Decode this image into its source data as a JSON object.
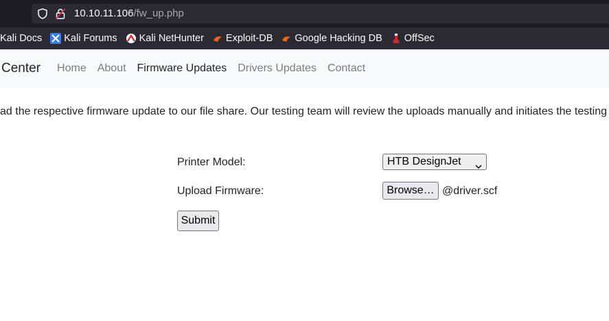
{
  "browser": {
    "url_host": "10.10.11.106",
    "url_path": "/fw_up.php",
    "bookmarks": [
      {
        "label": "Kali Docs",
        "icon": "kali-icon"
      },
      {
        "label": "Kali Forums",
        "icon": "kali-forums-icon"
      },
      {
        "label": "Kali NetHunter",
        "icon": "nethunter-icon"
      },
      {
        "label": "Exploit-DB",
        "icon": "exploit-db-icon"
      },
      {
        "label": "Google Hacking DB",
        "icon": "ghdb-icon"
      },
      {
        "label": "OffSec",
        "icon": "offsec-icon"
      }
    ]
  },
  "navbar": {
    "brand": "Center",
    "links": [
      "Home",
      "About",
      "Firmware Updates",
      "Drivers Updates",
      "Contact"
    ],
    "active": "Firmware Updates"
  },
  "intro": "ad the respective firmware update to our file share. Our testing team will review the uploads manually and initiates the testing",
  "form": {
    "printer_model_label": "Printer Model:",
    "printer_model_value": "HTB DesignJet",
    "upload_label": "Upload Firmware:",
    "browse_label": "Browse…",
    "file_name": "@driver.scf",
    "submit_label": "Submit"
  }
}
